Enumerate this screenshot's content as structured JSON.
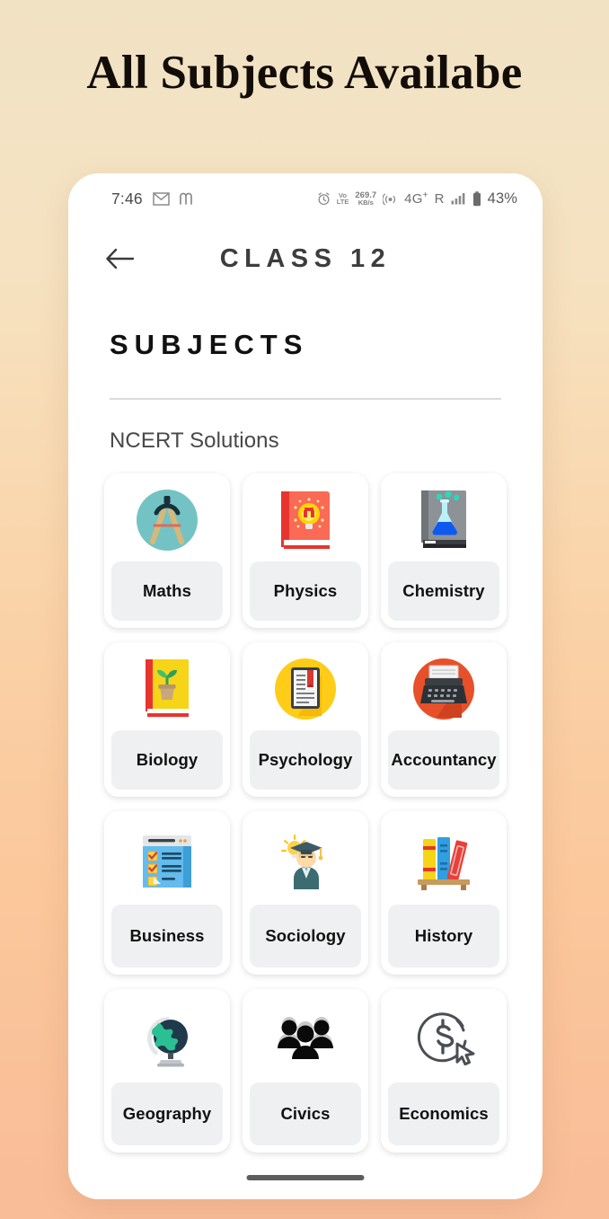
{
  "poster": {
    "title": "All Subjects Availabe",
    "background_top": "#f1e2c3",
    "background_bottom": "#f9bd98"
  },
  "status_bar": {
    "time": "7:46",
    "gmail_icon": "gmail-icon",
    "m_icon": "m-app-icon",
    "alarm_icon": "alarm-icon",
    "volte_line1": "Vo",
    "volte_line2": "LTE",
    "net_speed_value": "269.7",
    "net_speed_unit": "KB/s",
    "hotspot_icon": "hotspot-icon",
    "network_type": "4G",
    "network_type_sup": "+",
    "roaming": "R",
    "signal_icon": "signal-bars-icon",
    "battery_icon": "battery-icon",
    "battery_percent": "43%"
  },
  "app_bar": {
    "back_icon": "back-arrow-icon",
    "title": "CLASS 12"
  },
  "page": {
    "section_title": "SUBJECTS",
    "group_label": "NCERT Solutions"
  },
  "subjects": [
    {
      "label": "Maths",
      "icon": "compass-icon"
    },
    {
      "label": "Physics",
      "icon": "physics-book-lightbulb-icon"
    },
    {
      "label": "Chemistry",
      "icon": "chemistry-book-flask-icon"
    },
    {
      "label": "Biology",
      "icon": "biology-book-plant-icon"
    },
    {
      "label": "Psychology",
      "icon": "open-book-bookmark-icon"
    },
    {
      "label": "Accountancy",
      "icon": "typewriter-icon"
    },
    {
      "label": "Business",
      "icon": "checklist-document-icon"
    },
    {
      "label": "Sociology",
      "icon": "graduate-lightbulb-icon"
    },
    {
      "label": "History",
      "icon": "bookshelf-icon"
    },
    {
      "label": "Geography",
      "icon": "globe-icon"
    },
    {
      "label": "Civics",
      "icon": "people-group-icon"
    },
    {
      "label": "Economics",
      "icon": "dollar-coin-cursor-icon"
    }
  ],
  "gesture_bar": "home-indicator"
}
